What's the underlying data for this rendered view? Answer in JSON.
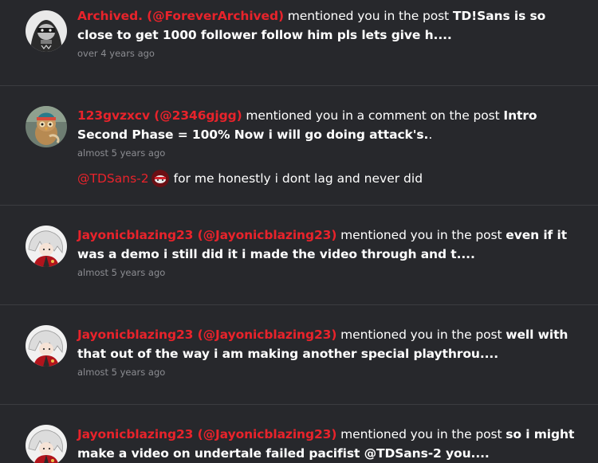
{
  "notifications": [
    {
      "user": "Archived. (@ForeverArchived)",
      "action": " mentioned you in the post ",
      "post": "TD!Sans is so close to get 1000 follower follow him pls lets give h....",
      "time": "over 4 years ago",
      "avatar_icon": "hooded-character-avatar"
    },
    {
      "user": "123gvzxcv (@2346gjgg)",
      "action": " mentioned you in a comment on the post ",
      "post": "Intro Second Phase = 100% Now i will go doing attack's.",
      "post_suffix": ".",
      "time": "almost 5 years ago",
      "comment_mention": "@TDSans-2",
      "comment_text": "for me honestly i dont lag and never did",
      "avatar_icon": "owl-avatar"
    },
    {
      "user": "Jayonicblazing23 (@Jayonicblazing23)",
      "action": " mentioned you in the post ",
      "post": "even if it was a demo i still did it i made the video through and t....",
      "time": "almost 5 years ago",
      "avatar_icon": "anime-character-avatar"
    },
    {
      "user": "Jayonicblazing23 (@Jayonicblazing23)",
      "action": " mentioned you in the post ",
      "post": "well with that out of the way i am making another special playthrou....",
      "time": "almost 5 years ago",
      "avatar_icon": "anime-character-avatar"
    },
    {
      "user": "Jayonicblazing23 (@Jayonicblazing23)",
      "action": " mentioned you in the post ",
      "post": "so i might make a video on undertale failed pacifist @TDSans-2 you....",
      "time": "",
      "avatar_icon": "anime-character-avatar"
    }
  ],
  "colors": {
    "background": "#27282c",
    "username": "#e8232b",
    "timestamp": "#8c8d92",
    "divider": "#3b3c40"
  }
}
